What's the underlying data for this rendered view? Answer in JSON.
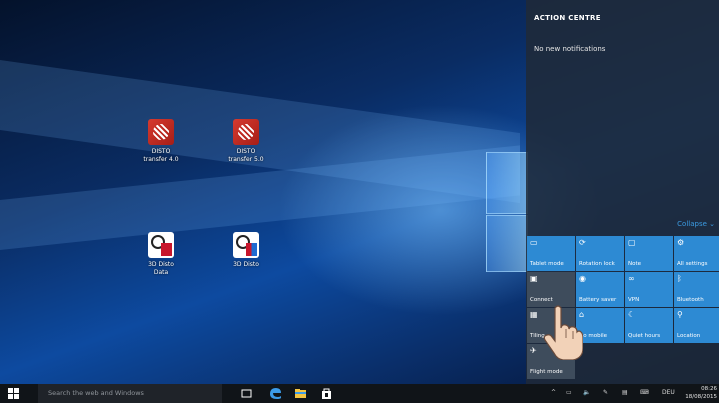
{
  "desktop": {
    "icons": [
      {
        "label_line1": "DISTO",
        "label_line2": "transfer 4.0"
      },
      {
        "label_line1": "DISTO",
        "label_line2": "transfer 5.0"
      },
      {
        "label_line1": "3D Disto",
        "label_line2": "Data"
      },
      {
        "label_line1": "3D Disto",
        "label_line2": ""
      }
    ]
  },
  "action_centre": {
    "title": "ACTION CENTRE",
    "empty_text": "No new notifications",
    "collapse_label": "Collapse ⌄",
    "tiles": [
      {
        "label": "Tablet mode",
        "icon": "tablet-mode-icon",
        "on": true
      },
      {
        "label": "Rotation lock",
        "icon": "rotation-lock-icon",
        "on": true
      },
      {
        "label": "Note",
        "icon": "note-icon",
        "on": true
      },
      {
        "label": "All settings",
        "icon": "settings-icon",
        "on": true
      },
      {
        "label": "Connect",
        "icon": "connect-icon",
        "on": false
      },
      {
        "label": "Battery saver",
        "icon": "battery-saver-icon",
        "on": true
      },
      {
        "label": "VPN",
        "icon": "vpn-icon",
        "on": true
      },
      {
        "label": "Bluetooth",
        "icon": "bluetooth-icon",
        "on": true
      },
      {
        "label": "Tiling",
        "icon": "tiling-icon",
        "on": false
      },
      {
        "label": "Go mobile",
        "icon": "go-mobile-icon",
        "on": true
      },
      {
        "label": "Quiet hours",
        "icon": "quiet-hours-icon",
        "on": true
      },
      {
        "label": "Location",
        "icon": "location-icon",
        "on": true
      },
      {
        "label": "Flight mode",
        "icon": "flight-mode-icon",
        "on": false
      }
    ],
    "accent": "#2d8ad3"
  },
  "taskbar": {
    "search_placeholder": "Search the web and Windows",
    "language": "DEU",
    "time": "08:26",
    "date": "18/08/2015"
  }
}
